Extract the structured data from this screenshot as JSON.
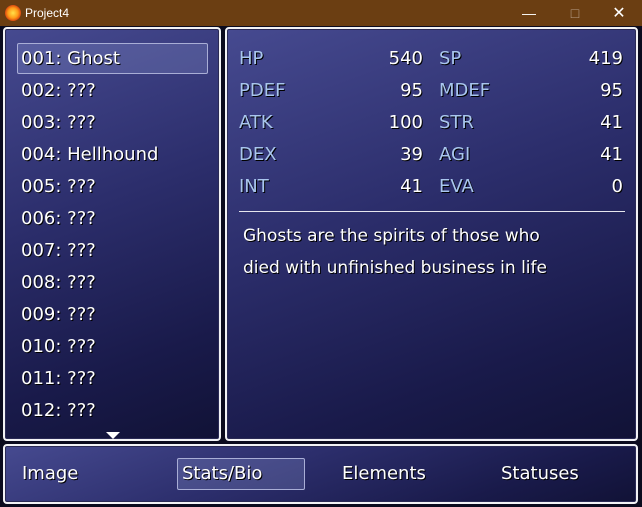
{
  "window": {
    "title": "Project4",
    "minimize_icon": "minimize-icon",
    "maximize_icon": "maximize-icon",
    "close_icon": "close-icon"
  },
  "monster_list": {
    "items": [
      "001: Ghost",
      "002: ???",
      "003: ???",
      "004: Hellhound",
      "005: ???",
      "006: ???",
      "007: ???",
      "008: ???",
      "009: ???",
      "010: ???",
      "011: ???",
      "012: ???"
    ],
    "selected": "001: Ghost",
    "more_indicator": "scroll-down-arrow-icon"
  },
  "stats": {
    "hp_label": "HP",
    "hp": "540",
    "sp_label": "SP",
    "sp": "419",
    "pdef_label": "PDEF",
    "pdef": "95",
    "mdef_label": "MDEF",
    "mdef": "95",
    "atk_label": "ATK",
    "atk": "100",
    "str_label": "STR",
    "str": "41",
    "dex_label": "DEX",
    "dex": "39",
    "agi_label": "AGI",
    "agi": "41",
    "int_label": "INT",
    "int": "41",
    "eva_label": "EVA",
    "eva": "0"
  },
  "bio": {
    "line1": "Ghosts are the spirits of those who",
    "line2": "died with unfinished business in life"
  },
  "menu": {
    "image": "Image",
    "stats_bio": "Stats/Bio",
    "elements": "Elements",
    "statuses": "Statuses",
    "selected": "Stats/Bio"
  }
}
